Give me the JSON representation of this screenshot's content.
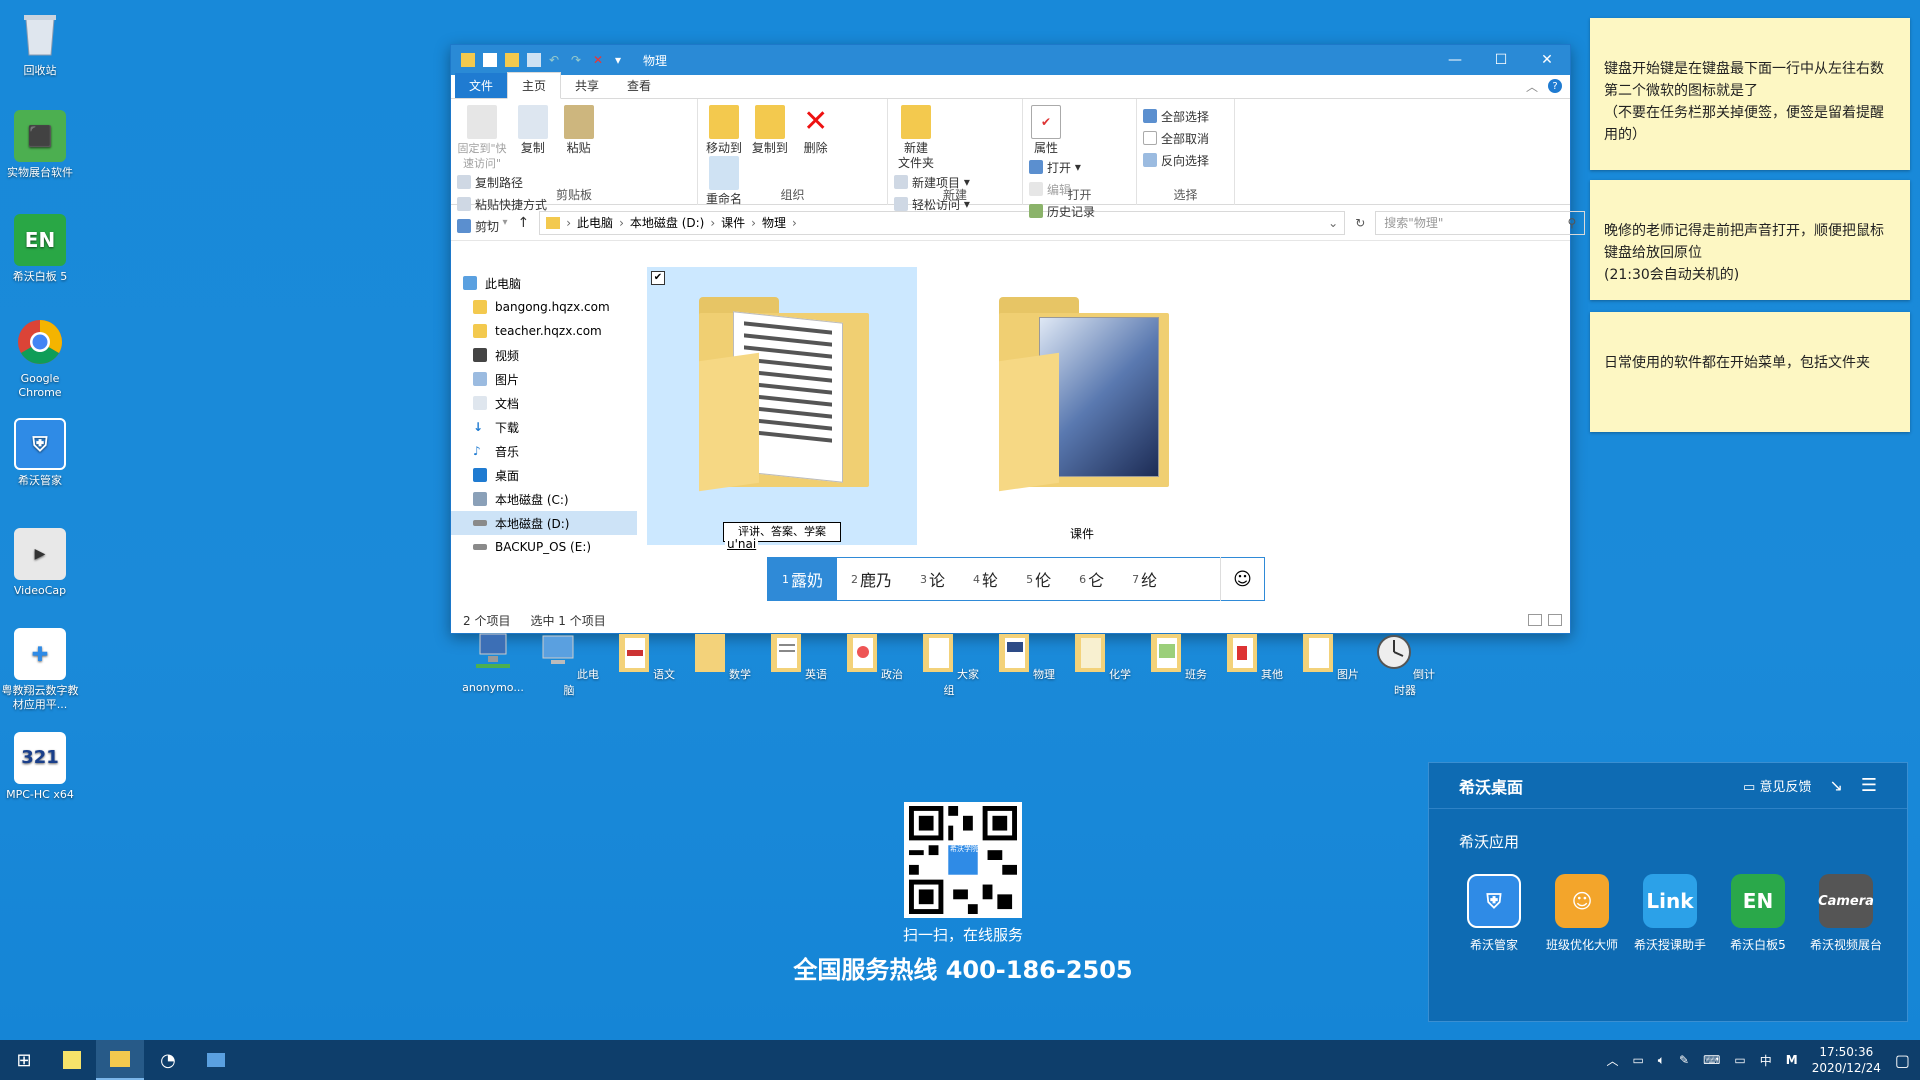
{
  "desktop": {
    "icons": [
      {
        "label": "回收站",
        "icon": "recycle-bin-icon"
      },
      {
        "label": "实物展台软件",
        "icon": "document-camera-icon"
      },
      {
        "label": "希沃白板 5",
        "icon": "easinote-icon"
      },
      {
        "label": "Google Chrome",
        "icon": "chrome-icon"
      },
      {
        "label": "希沃管家",
        "icon": "seewo-manager-icon"
      },
      {
        "label": "VideoCap",
        "icon": "videocap-icon"
      },
      {
        "label": "粤教翔云数字教材应用平...",
        "icon": "textbook-platform-icon"
      },
      {
        "label": "MPC-HC x64",
        "icon": "mpc-hc-icon"
      }
    ],
    "row_items": [
      {
        "label": "anonymo...",
        "icon": "network-computer-icon"
      },
      {
        "label": "此电脑",
        "icon": "this-pc-icon"
      },
      {
        "label": "语文",
        "icon": "folder-icon"
      },
      {
        "label": "数学",
        "icon": "folder-icon"
      },
      {
        "label": "英语",
        "icon": "folder-icon"
      },
      {
        "label": "政治",
        "icon": "folder-icon"
      },
      {
        "label": "大家组",
        "icon": "folder-icon"
      },
      {
        "label": "物理",
        "icon": "folder-icon"
      },
      {
        "label": "化学",
        "icon": "folder-icon"
      },
      {
        "label": "班务",
        "icon": "folder-icon"
      },
      {
        "label": "其他",
        "icon": "folder-icon"
      },
      {
        "label": "图片",
        "icon": "folder-icon"
      },
      {
        "label": "倒计时器",
        "icon": "timer-icon"
      }
    ]
  },
  "notes": [
    "键盘开始键是在键盘最下面一行中从左往右数第二个微软的图标就是了\n（不要在任务栏那关掉便签，便签是留着提醒用的）",
    "晚修的老师记得走前把声音打开，顺便把鼠标键盘给放回原位\n(21:30会自动关机的)",
    "日常使用的软件都在开始菜单，包括文件夹"
  ],
  "explorer": {
    "title": "物理",
    "tabs": [
      "文件",
      "主页",
      "共享",
      "查看"
    ],
    "ribbon": {
      "clipboard": {
        "name": "剪贴板",
        "pin": "固定到\"快速访问\"",
        "copy": "复制",
        "paste": "粘贴",
        "copy_path": "复制路径",
        "paste_shortcut": "粘贴快捷方式",
        "cut": "剪切"
      },
      "organize": {
        "name": "组织",
        "move_to": "移动到",
        "copy_to": "复制到",
        "delete": "删除",
        "rename": "重命名"
      },
      "new": {
        "name": "新建",
        "new_folder": "新建\n文件夹",
        "new_item": "新建项目",
        "easy_access": "轻松访问"
      },
      "open": {
        "name": "打开",
        "properties": "属性",
        "open": "打开",
        "edit": "编辑",
        "history": "历史记录"
      },
      "select": {
        "name": "选择",
        "select_all": "全部选择",
        "select_none": "全部取消",
        "invert": "反向选择"
      }
    },
    "breadcrumb": [
      "此电脑",
      "本地磁盘 (D:)",
      "课件",
      "物理"
    ],
    "search_placeholder": "搜索\"物理\"",
    "nav": [
      {
        "label": "此电脑",
        "root": true
      },
      {
        "label": "bangong.hqzx.com"
      },
      {
        "label": "teacher.hqzx.com"
      },
      {
        "label": "视频"
      },
      {
        "label": "图片"
      },
      {
        "label": "文档"
      },
      {
        "label": "下载"
      },
      {
        "label": "音乐"
      },
      {
        "label": "桌面"
      },
      {
        "label": "本地磁盘 (C:)"
      },
      {
        "label": "本地磁盘 (D:)",
        "selected": true
      },
      {
        "label": "BACKUP_OS (E:)"
      }
    ],
    "items": [
      {
        "name": "评讲、答案、学案",
        "renaming": true,
        "selected": true
      },
      {
        "name": "课件"
      }
    ],
    "ime": {
      "composition": "u'nai",
      "candidates": [
        {
          "n": "1",
          "text": "露奶"
        },
        {
          "n": "2",
          "text": "鹿乃"
        },
        {
          "n": "3",
          "text": "论"
        },
        {
          "n": "4",
          "text": "轮"
        },
        {
          "n": "5",
          "text": "伦"
        },
        {
          "n": "6",
          "text": "仑"
        },
        {
          "n": "7",
          "text": "纶"
        }
      ],
      "emoji": "☺"
    },
    "status": {
      "count": "2 个项目",
      "selected": "选中 1 个项目"
    }
  },
  "qr": {
    "caption": "扫一扫，在线服务",
    "center_label": "希沃学院",
    "hotline": "全国服务热线 400-186-2505"
  },
  "xiwo_panel": {
    "title": "希沃桌面",
    "feedback": "意见反馈",
    "section": "希沃应用",
    "apps": [
      {
        "label": "希沃管家",
        "icon": "seewo-manager-icon",
        "color": "#2f8be6"
      },
      {
        "label": "班级优化大师",
        "icon": "class-master-icon",
        "color": "#f3a52b"
      },
      {
        "label": "希沃授课助手",
        "icon": "link-icon",
        "color": "#2ca1e8",
        "glyph": "Link"
      },
      {
        "label": "希沃白板5",
        "icon": "easinote-icon",
        "color": "#2aa84a",
        "glyph": "EN"
      },
      {
        "label": "希沃视频展台",
        "icon": "camera-icon",
        "color": "#555",
        "glyph": "Camera"
      }
    ]
  },
  "taskbar": {
    "time": "17:50:36",
    "date": "2020/12/24",
    "ime_indicator": "中",
    "ime_mode": "M"
  }
}
